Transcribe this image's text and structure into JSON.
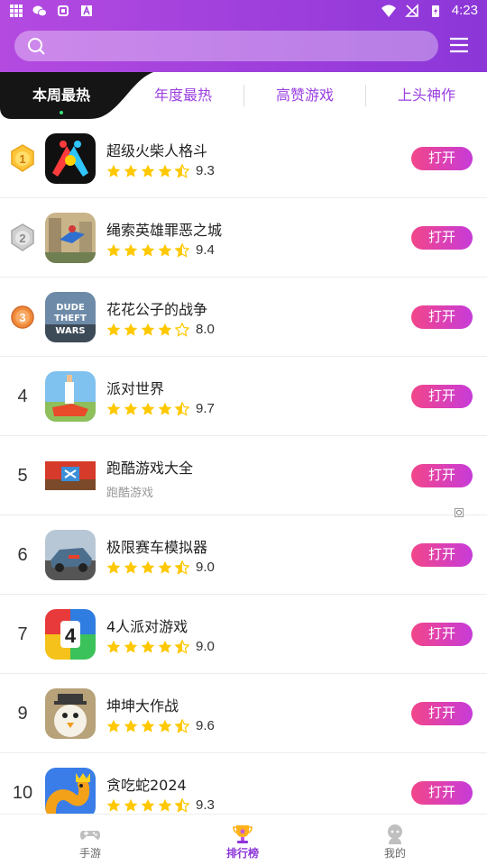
{
  "status_bar": {
    "time": "4:23"
  },
  "search": {
    "placeholder": ""
  },
  "tabs": [
    {
      "label": "本周最热",
      "active": true
    },
    {
      "label": "年度最热",
      "active": false
    },
    {
      "label": "高赞游戏",
      "active": false
    },
    {
      "label": "上头神作",
      "active": false
    }
  ],
  "games": [
    {
      "rank": "1",
      "name": "超级火柴人格斗",
      "score": "9.3",
      "stars": 4.5,
      "button": "打开"
    },
    {
      "rank": "2",
      "name": "绳索英雄罪恶之城",
      "score": "9.4",
      "stars": 4.5,
      "button": "打开"
    },
    {
      "rank": "3",
      "name": "花花公子的战争",
      "score": "8.0",
      "stars": 4,
      "button": "打开"
    },
    {
      "rank": "4",
      "name": "派对世界",
      "score": "9.7",
      "stars": 4.5,
      "button": "打开"
    },
    {
      "rank": "5",
      "name": "跑酷游戏大全",
      "subtitle": "跑酷游戏",
      "button": "打开"
    },
    {
      "rank": "6",
      "name": "极限赛车模拟器",
      "score": "9.0",
      "stars": 4.5,
      "button": "打开"
    },
    {
      "rank": "7",
      "name": "4人派对游戏",
      "score": "9.0",
      "stars": 4.5,
      "button": "打开"
    },
    {
      "rank": "9",
      "name": "坤坤大作战",
      "score": "9.6",
      "stars": 4.5,
      "button": "打开"
    },
    {
      "rank": "10",
      "name": "贪吃蛇2024",
      "score": "9.3",
      "stars": 4.5,
      "button": "打开"
    }
  ],
  "bottom_nav": [
    {
      "label": "手游",
      "icon": "gamepad-icon",
      "active": false
    },
    {
      "label": "排行榜",
      "icon": "trophy-icon",
      "active": true
    },
    {
      "label": "我的",
      "icon": "profile-icon",
      "active": false
    }
  ],
  "colors": {
    "header": "#9b3fe0",
    "accent": "#8c36d8",
    "button_start": "#f2468a",
    "button_end": "#c73bd8",
    "star": "#ffc800"
  }
}
